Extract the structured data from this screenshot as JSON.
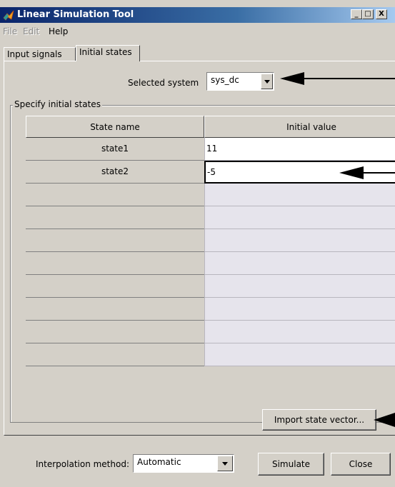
{
  "window": {
    "title": "Linear Simulation Tool"
  },
  "titlebar_buttons": {
    "minimize": "_",
    "maximize": "□",
    "close": "X"
  },
  "menu": [
    {
      "label": "File",
      "enabled": false
    },
    {
      "label": "Edit",
      "enabled": false
    },
    {
      "label": "Help",
      "enabled": true
    }
  ],
  "tabs": [
    {
      "label": "Input signals",
      "active": false
    },
    {
      "label": "Initial states",
      "active": true
    }
  ],
  "selected_system": {
    "label": "Selected system",
    "value": "sys_dc"
  },
  "group": {
    "label": "Specify initial states"
  },
  "table": {
    "headers": [
      "State name",
      "Initial value"
    ],
    "rows": [
      {
        "name": "state1",
        "value": "11"
      },
      {
        "name": "state2",
        "value": "-5"
      },
      {
        "name": "",
        "value": ""
      },
      {
        "name": "",
        "value": ""
      },
      {
        "name": "",
        "value": ""
      },
      {
        "name": "",
        "value": ""
      },
      {
        "name": "",
        "value": ""
      },
      {
        "name": "",
        "value": ""
      },
      {
        "name": "",
        "value": ""
      },
      {
        "name": "",
        "value": ""
      }
    ]
  },
  "import_button": {
    "label": "Import state vector..."
  },
  "interpolation": {
    "label": "Interpolation method:",
    "value": "Automatic"
  },
  "buttons": {
    "simulate": "Simulate",
    "close": "Close"
  },
  "colors": {
    "title_bar": "#0a246a",
    "face": "#d4d0c8",
    "empty_cell": "#e6e4ec"
  }
}
